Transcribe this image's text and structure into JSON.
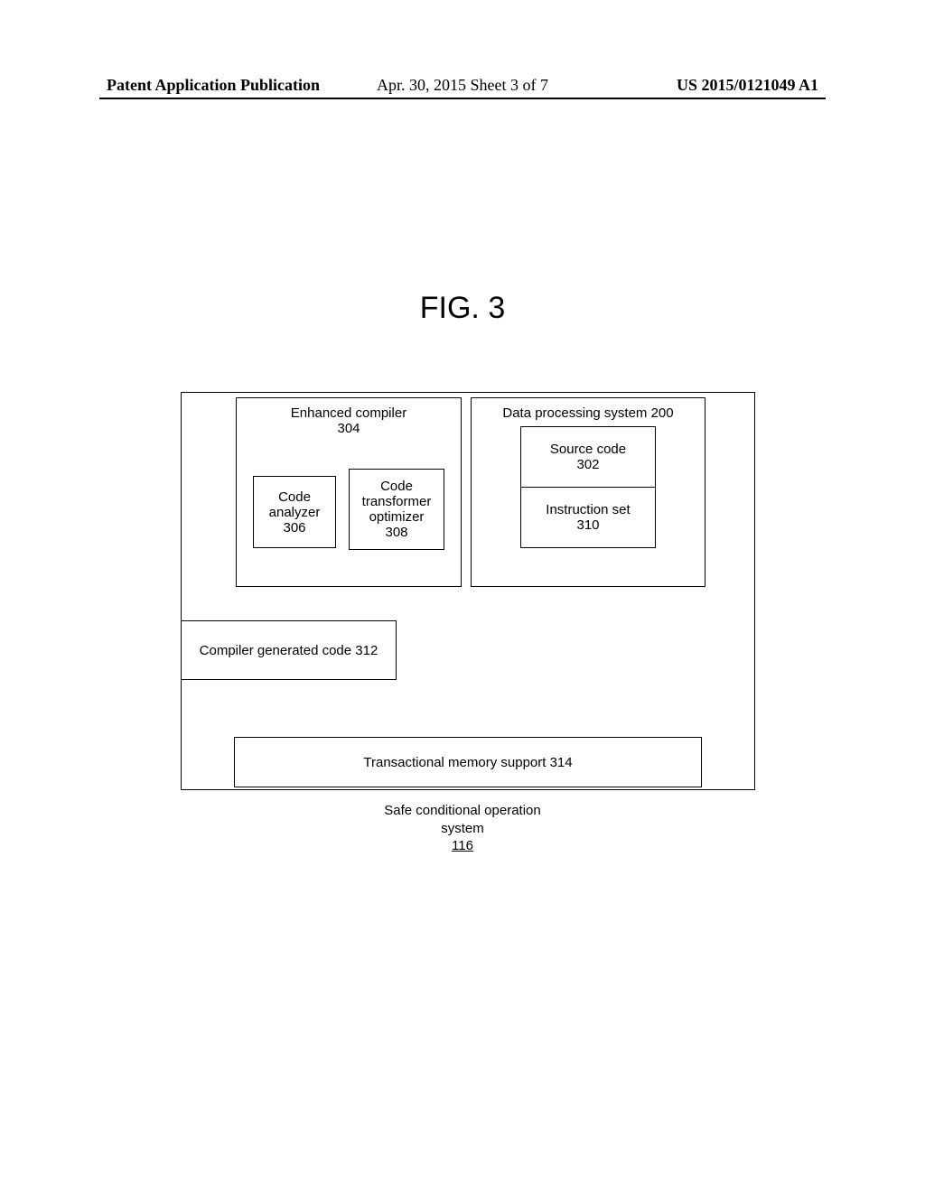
{
  "header": {
    "left": "Patent Application Publication",
    "center": "Apr. 30, 2015  Sheet 3 of 7",
    "right": "US 2015/0121049 A1"
  },
  "figure": {
    "title": "FIG. 3"
  },
  "compiler": {
    "title_l1": "Enhanced compiler",
    "title_l2": "304",
    "analyzer_l1": "Code",
    "analyzer_l2": "analyzer",
    "analyzer_l3": "306",
    "optimizer_l1": "Code",
    "optimizer_l2": "transformer",
    "optimizer_l3": "optimizer",
    "optimizer_l4": "308"
  },
  "dps": {
    "title": "Data processing system 200",
    "src_l1": "Source code",
    "src_l2": "302",
    "instr_l1": "Instruction set",
    "instr_l2": "310"
  },
  "cgc": {
    "label": "Compiler generated code 312"
  },
  "tms": {
    "label": "Transactional memory support 314"
  },
  "caption": {
    "l1": "Safe conditional operation",
    "l2": "system",
    "l3": "116"
  }
}
